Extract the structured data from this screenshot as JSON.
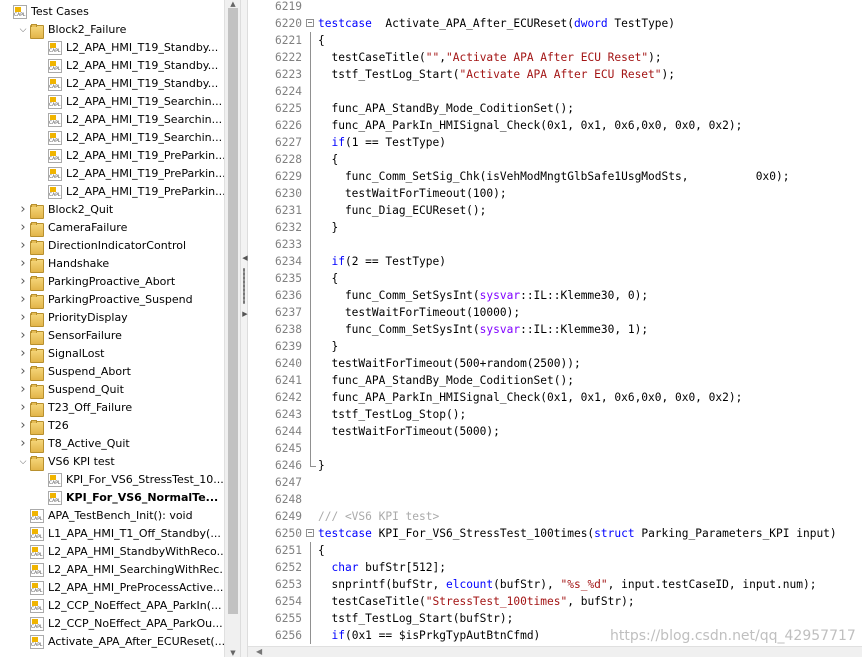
{
  "tree": {
    "items": [
      {
        "label": "Test Cases",
        "level": 0,
        "icon": "capl-icon",
        "arrow": ""
      },
      {
        "label": "Block2_Failure",
        "level": 1,
        "icon": "folder-icon",
        "arrow": "expanded"
      },
      {
        "label": "L2_APA_HMI_T19_Standby...",
        "level": 2,
        "icon": "capl-icon",
        "arrow": ""
      },
      {
        "label": "L2_APA_HMI_T19_Standby...",
        "level": 2,
        "icon": "capl-icon",
        "arrow": ""
      },
      {
        "label": "L2_APA_HMI_T19_Standby...",
        "level": 2,
        "icon": "capl-icon",
        "arrow": ""
      },
      {
        "label": "L2_APA_HMI_T19_Searchin...",
        "level": 2,
        "icon": "capl-icon",
        "arrow": ""
      },
      {
        "label": "L2_APA_HMI_T19_Searchin...",
        "level": 2,
        "icon": "capl-icon",
        "arrow": ""
      },
      {
        "label": "L2_APA_HMI_T19_Searchin...",
        "level": 2,
        "icon": "capl-icon",
        "arrow": ""
      },
      {
        "label": "L2_APA_HMI_T19_PreParkin...",
        "level": 2,
        "icon": "capl-icon",
        "arrow": ""
      },
      {
        "label": "L2_APA_HMI_T19_PreParkin...",
        "level": 2,
        "icon": "capl-icon",
        "arrow": ""
      },
      {
        "label": "L2_APA_HMI_T19_PreParkin...",
        "level": 2,
        "icon": "capl-icon",
        "arrow": ""
      },
      {
        "label": "Block2_Quit",
        "level": 1,
        "icon": "folder-icon",
        "arrow": "collapsed"
      },
      {
        "label": "CameraFailure",
        "level": 1,
        "icon": "folder-icon",
        "arrow": "collapsed"
      },
      {
        "label": "DirectionIndicatorControl",
        "level": 1,
        "icon": "folder-icon",
        "arrow": "collapsed"
      },
      {
        "label": "Handshake",
        "level": 1,
        "icon": "folder-icon",
        "arrow": "collapsed"
      },
      {
        "label": "ParkingProactive_Abort",
        "level": 1,
        "icon": "folder-icon",
        "arrow": "collapsed"
      },
      {
        "label": "ParkingProactive_Suspend",
        "level": 1,
        "icon": "folder-icon",
        "arrow": "collapsed"
      },
      {
        "label": "PriorityDisplay",
        "level": 1,
        "icon": "folder-icon",
        "arrow": "collapsed"
      },
      {
        "label": "SensorFailure",
        "level": 1,
        "icon": "folder-icon",
        "arrow": "collapsed"
      },
      {
        "label": "SignalLost",
        "level": 1,
        "icon": "folder-icon",
        "arrow": "collapsed"
      },
      {
        "label": "Suspend_Abort",
        "level": 1,
        "icon": "folder-icon",
        "arrow": "collapsed"
      },
      {
        "label": "Suspend_Quit",
        "level": 1,
        "icon": "folder-icon",
        "arrow": "collapsed"
      },
      {
        "label": "T23_Off_Failure",
        "level": 1,
        "icon": "folder-icon",
        "arrow": "collapsed"
      },
      {
        "label": "T26",
        "level": 1,
        "icon": "folder-icon",
        "arrow": "collapsed"
      },
      {
        "label": "T8_Active_Quit",
        "level": 1,
        "icon": "folder-icon",
        "arrow": "collapsed"
      },
      {
        "label": "VS6 KPI test",
        "level": 1,
        "icon": "folder-icon",
        "arrow": "expanded"
      },
      {
        "label": "KPI_For_VS6_StressTest_10...",
        "level": 2,
        "icon": "capl-icon",
        "arrow": ""
      },
      {
        "label": "KPI_For_VS6_NormalTe...",
        "level": 2,
        "icon": "capl-icon",
        "arrow": "",
        "selected": true
      },
      {
        "label": "APA_TestBench_Init(): void",
        "level": 1,
        "icon": "capl-icon",
        "arrow": ""
      },
      {
        "label": "L1_APA_HMI_T1_Off_Standby(...",
        "level": 1,
        "icon": "capl-icon",
        "arrow": ""
      },
      {
        "label": "L2_APA_HMI_StandbyWithReco...",
        "level": 1,
        "icon": "capl-icon",
        "arrow": ""
      },
      {
        "label": "L2_APA_HMI_SearchingWithRec...",
        "level": 1,
        "icon": "capl-icon",
        "arrow": ""
      },
      {
        "label": "L2_APA_HMI_PreProcessActive...",
        "level": 1,
        "icon": "capl-icon",
        "arrow": ""
      },
      {
        "label": "L2_CCP_NoEffect_APA_ParkIn(...",
        "level": 1,
        "icon": "capl-icon",
        "arrow": ""
      },
      {
        "label": "L2_CCP_NoEffect_APA_ParkOu...",
        "level": 1,
        "icon": "capl-icon",
        "arrow": ""
      },
      {
        "label": "Activate_APA_After_ECUReset(...",
        "level": 1,
        "icon": "capl-icon",
        "arrow": ""
      }
    ]
  },
  "editor": {
    "lines": [
      {
        "num": "6219",
        "fold": "",
        "segs": []
      },
      {
        "num": "6220",
        "fold": "open",
        "segs": [
          [
            "kw",
            "testcase"
          ],
          [
            "",
            "  Activate_APA_After_ECUReset("
          ],
          [
            "kw",
            "dword"
          ],
          [
            "",
            " TestType)"
          ]
        ]
      },
      {
        "num": "6221",
        "fold": "bar",
        "segs": [
          [
            "",
            "{"
          ]
        ]
      },
      {
        "num": "6222",
        "fold": "bar",
        "segs": [
          [
            "",
            "  testCaseTitle("
          ],
          [
            "str",
            "\"\""
          ],
          [
            "",
            ","
          ],
          [
            "str",
            "\"Activate APA After ECU Reset\""
          ],
          [
            "",
            ");"
          ]
        ]
      },
      {
        "num": "6223",
        "fold": "bar",
        "segs": [
          [
            "",
            "  tstf_TestLog_Start("
          ],
          [
            "str",
            "\"Activate APA After ECU Reset\""
          ],
          [
            "",
            ");"
          ]
        ]
      },
      {
        "num": "6224",
        "fold": "bar",
        "segs": []
      },
      {
        "num": "6225",
        "fold": "bar",
        "segs": [
          [
            "",
            "  func_APA_StandBy_Mode_CoditionSet();"
          ]
        ]
      },
      {
        "num": "6226",
        "fold": "bar",
        "segs": [
          [
            "",
            "  func_APA_ParkIn_HMISignal_Check(0x1, 0x1, 0x6,0x0, 0x0, 0x2);"
          ]
        ]
      },
      {
        "num": "6227",
        "fold": "bar",
        "segs": [
          [
            "",
            "  "
          ],
          [
            "kw",
            "if"
          ],
          [
            "",
            "(1 == TestType)"
          ]
        ]
      },
      {
        "num": "6228",
        "fold": "bar",
        "segs": [
          [
            "",
            "  {"
          ]
        ]
      },
      {
        "num": "6229",
        "fold": "bar",
        "segs": [
          [
            "",
            "    func_Comm_SetSig_Chk(isVehModMngtGlbSafe1UsgModSts,          0x0);"
          ]
        ]
      },
      {
        "num": "6230",
        "fold": "bar",
        "segs": [
          [
            "",
            "    testWaitForTimeout(100);"
          ]
        ]
      },
      {
        "num": "6231",
        "fold": "bar",
        "segs": [
          [
            "",
            "    func_Diag_ECUReset();"
          ]
        ]
      },
      {
        "num": "6232",
        "fold": "bar",
        "segs": [
          [
            "",
            "  }"
          ]
        ]
      },
      {
        "num": "6233",
        "fold": "bar",
        "segs": []
      },
      {
        "num": "6234",
        "fold": "bar",
        "segs": [
          [
            "",
            "  "
          ],
          [
            "kw",
            "if"
          ],
          [
            "",
            "(2 == TestType)"
          ]
        ]
      },
      {
        "num": "6235",
        "fold": "bar",
        "segs": [
          [
            "",
            "  {"
          ]
        ]
      },
      {
        "num": "6236",
        "fold": "bar",
        "segs": [
          [
            "",
            "    func_Comm_SetSysInt("
          ],
          [
            "sv",
            "sysvar"
          ],
          [
            "",
            "::IL::Klemme30, 0);"
          ]
        ]
      },
      {
        "num": "6237",
        "fold": "bar",
        "segs": [
          [
            "",
            "    testWaitForTimeout(10000);"
          ]
        ]
      },
      {
        "num": "6238",
        "fold": "bar",
        "segs": [
          [
            "",
            "    func_Comm_SetSysInt("
          ],
          [
            "sv",
            "sysvar"
          ],
          [
            "",
            "::IL::Klemme30, 1);"
          ]
        ]
      },
      {
        "num": "6239",
        "fold": "bar",
        "segs": [
          [
            "",
            "  }"
          ]
        ]
      },
      {
        "num": "6240",
        "fold": "bar",
        "segs": [
          [
            "",
            "  testWaitForTimeout(500+random(2500));"
          ]
        ]
      },
      {
        "num": "6241",
        "fold": "bar",
        "segs": [
          [
            "",
            "  func_APA_StandBy_Mode_CoditionSet();"
          ]
        ]
      },
      {
        "num": "6242",
        "fold": "bar",
        "segs": [
          [
            "",
            "  func_APA_ParkIn_HMISignal_Check(0x1, 0x1, 0x6,0x0, 0x0, 0x2);"
          ]
        ]
      },
      {
        "num": "6243",
        "fold": "bar",
        "segs": [
          [
            "",
            "  tstf_TestLog_Stop();"
          ]
        ]
      },
      {
        "num": "6244",
        "fold": "bar",
        "segs": [
          [
            "",
            "  testWaitForTimeout(5000);"
          ]
        ]
      },
      {
        "num": "6245",
        "fold": "bar",
        "segs": []
      },
      {
        "num": "6246",
        "fold": "end",
        "segs": [
          [
            "",
            "}"
          ]
        ]
      },
      {
        "num": "6247",
        "fold": "",
        "segs": []
      },
      {
        "num": "6248",
        "fold": "",
        "segs": []
      },
      {
        "num": "6249",
        "fold": "",
        "segs": [
          [
            "cmt",
            "/// <VS6 KPI test>"
          ]
        ]
      },
      {
        "num": "6250",
        "fold": "open",
        "segs": [
          [
            "kw",
            "testcase"
          ],
          [
            "",
            " KPI_For_VS6_StressTest_100times("
          ],
          [
            "kw",
            "struct"
          ],
          [
            "",
            " Parking_Parameters_KPI input)"
          ]
        ]
      },
      {
        "num": "6251",
        "fold": "bar",
        "segs": [
          [
            "",
            "{"
          ]
        ]
      },
      {
        "num": "6252",
        "fold": "bar",
        "segs": [
          [
            "",
            "  "
          ],
          [
            "kw",
            "char"
          ],
          [
            "",
            " bufStr[512];"
          ]
        ]
      },
      {
        "num": "6253",
        "fold": "bar",
        "segs": [
          [
            "",
            "  snprintf(bufStr, "
          ],
          [
            "kw",
            "elcount"
          ],
          [
            "",
            "(bufStr), "
          ],
          [
            "str",
            "\"%s_%d\""
          ],
          [
            "",
            ", input.testCaseID, input.num);"
          ]
        ]
      },
      {
        "num": "6254",
        "fold": "bar",
        "segs": [
          [
            "",
            "  testCaseTitle("
          ],
          [
            "str",
            "\"StressTest_100times\""
          ],
          [
            "",
            ", bufStr);"
          ]
        ]
      },
      {
        "num": "6255",
        "fold": "bar",
        "segs": [
          [
            "",
            "  tstf_TestLog_Start(bufStr);"
          ]
        ]
      },
      {
        "num": "6256",
        "fold": "bar",
        "segs": [
          [
            "",
            "  "
          ],
          [
            "kw",
            "if"
          ],
          [
            "",
            "(0x1 == $isPrkgTypAutBtnCfmd)"
          ]
        ]
      }
    ]
  },
  "watermark": "https://blog.csdn.net/qq_42957717"
}
